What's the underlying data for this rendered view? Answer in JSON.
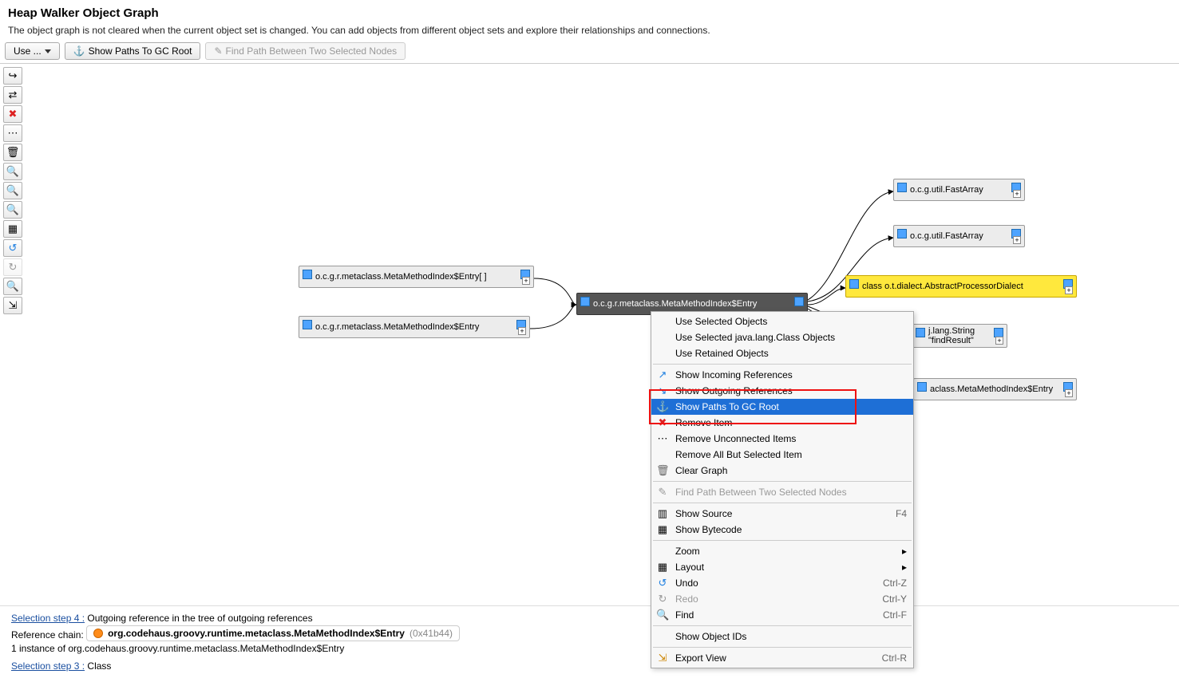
{
  "header": {
    "title": "Heap Walker Object Graph",
    "desc": "The object graph is not cleared when the current object set is changed. You can add objects from different object sets and explore their relationships and connections."
  },
  "toolbar": {
    "use": "Use ...",
    "show_paths": "Show Paths To GC Root",
    "find_path": "Find Path Between Two Selected Nodes"
  },
  "side_icons": {
    "a": "↪",
    "b": "⇄",
    "c": "✖",
    "d": "⋯",
    "e": "🗑",
    "f": "🔍",
    "g": "🔍",
    "h": "🔍",
    "i": "▦",
    "j": "↺",
    "k": "↻",
    "l": "🔍",
    "m": "⇲"
  },
  "nodes": {
    "n1": "o.c.g.r.metaclass.MetaMethodIndex$Entry[ ]",
    "n2": "o.c.g.r.metaclass.MetaMethodIndex$Entry",
    "n3": "o.c.g.r.metaclass.MetaMethodIndex$Entry",
    "n4": "o.c.g.util.FastArray",
    "n5": "o.c.g.util.FastArray",
    "n6": "class o.t.dialect.AbstractProcessorDialect",
    "n7a": "j.lang.String",
    "n7b": "\"findResult\"",
    "n8": "aclass.MetaMethodIndex$Entry"
  },
  "menu": {
    "use_sel": "Use Selected Objects",
    "use_class": "Use Selected java.lang.Class Objects",
    "use_ret": "Use Retained Objects",
    "show_in": "Show Incoming References",
    "show_out": "Show Outgoing References",
    "show_gc": "Show Paths To GC Root",
    "remove": "Remove Item",
    "remove_unc": "Remove Unconnected Items",
    "remove_all": "Remove All But Selected Item",
    "clear": "Clear Graph",
    "find_path": "Find Path Between Two Selected Nodes",
    "show_src": "Show Source",
    "show_bc": "Show Bytecode",
    "zoom": "Zoom",
    "layout": "Layout",
    "undo": "Undo",
    "redo": "Redo",
    "find": "Find",
    "show_ids": "Show Object IDs",
    "export": "Export View",
    "kb_f4": "F4",
    "kb_cz": "Ctrl-Z",
    "kb_cy": "Ctrl-Y",
    "kb_cf": "Ctrl-F",
    "kb_cr": "Ctrl-R"
  },
  "footer": {
    "step4_label": "Selection step 4 :",
    "step4_text": "Outgoing reference in the tree of outgoing references",
    "ref_label": "Reference chain:",
    "ref_class": "org.codehaus.groovy.runtime.metaclass.MetaMethodIndex$Entry",
    "ref_hex": "(0x41b44)",
    "inst_text": "1 instance of org.codehaus.groovy.runtime.metaclass.MetaMethodIndex$Entry",
    "step3_label": "Selection step 3 :",
    "step3_text": "Class"
  }
}
